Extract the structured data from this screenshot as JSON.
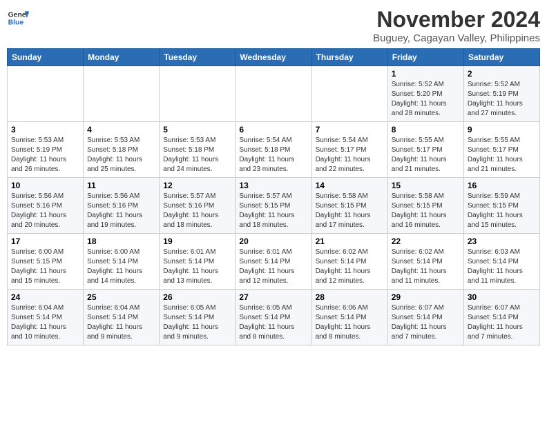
{
  "header": {
    "logo_line1": "General",
    "logo_line2": "Blue",
    "main_title": "November 2024",
    "subtitle": "Buguey, Cagayan Valley, Philippines"
  },
  "days_of_week": [
    "Sunday",
    "Monday",
    "Tuesday",
    "Wednesday",
    "Thursday",
    "Friday",
    "Saturday"
  ],
  "weeks": [
    [
      {
        "day": "",
        "info": ""
      },
      {
        "day": "",
        "info": ""
      },
      {
        "day": "",
        "info": ""
      },
      {
        "day": "",
        "info": ""
      },
      {
        "day": "",
        "info": ""
      },
      {
        "day": "1",
        "info": "Sunrise: 5:52 AM\nSunset: 5:20 PM\nDaylight: 11 hours\nand 28 minutes."
      },
      {
        "day": "2",
        "info": "Sunrise: 5:52 AM\nSunset: 5:19 PM\nDaylight: 11 hours\nand 27 minutes."
      }
    ],
    [
      {
        "day": "3",
        "info": "Sunrise: 5:53 AM\nSunset: 5:19 PM\nDaylight: 11 hours\nand 26 minutes."
      },
      {
        "day": "4",
        "info": "Sunrise: 5:53 AM\nSunset: 5:18 PM\nDaylight: 11 hours\nand 25 minutes."
      },
      {
        "day": "5",
        "info": "Sunrise: 5:53 AM\nSunset: 5:18 PM\nDaylight: 11 hours\nand 24 minutes."
      },
      {
        "day": "6",
        "info": "Sunrise: 5:54 AM\nSunset: 5:18 PM\nDaylight: 11 hours\nand 23 minutes."
      },
      {
        "day": "7",
        "info": "Sunrise: 5:54 AM\nSunset: 5:17 PM\nDaylight: 11 hours\nand 22 minutes."
      },
      {
        "day": "8",
        "info": "Sunrise: 5:55 AM\nSunset: 5:17 PM\nDaylight: 11 hours\nand 21 minutes."
      },
      {
        "day": "9",
        "info": "Sunrise: 5:55 AM\nSunset: 5:17 PM\nDaylight: 11 hours\nand 21 minutes."
      }
    ],
    [
      {
        "day": "10",
        "info": "Sunrise: 5:56 AM\nSunset: 5:16 PM\nDaylight: 11 hours\nand 20 minutes."
      },
      {
        "day": "11",
        "info": "Sunrise: 5:56 AM\nSunset: 5:16 PM\nDaylight: 11 hours\nand 19 minutes."
      },
      {
        "day": "12",
        "info": "Sunrise: 5:57 AM\nSunset: 5:16 PM\nDaylight: 11 hours\nand 18 minutes."
      },
      {
        "day": "13",
        "info": "Sunrise: 5:57 AM\nSunset: 5:15 PM\nDaylight: 11 hours\nand 18 minutes."
      },
      {
        "day": "14",
        "info": "Sunrise: 5:58 AM\nSunset: 5:15 PM\nDaylight: 11 hours\nand 17 minutes."
      },
      {
        "day": "15",
        "info": "Sunrise: 5:58 AM\nSunset: 5:15 PM\nDaylight: 11 hours\nand 16 minutes."
      },
      {
        "day": "16",
        "info": "Sunrise: 5:59 AM\nSunset: 5:15 PM\nDaylight: 11 hours\nand 15 minutes."
      }
    ],
    [
      {
        "day": "17",
        "info": "Sunrise: 6:00 AM\nSunset: 5:15 PM\nDaylight: 11 hours\nand 15 minutes."
      },
      {
        "day": "18",
        "info": "Sunrise: 6:00 AM\nSunset: 5:14 PM\nDaylight: 11 hours\nand 14 minutes."
      },
      {
        "day": "19",
        "info": "Sunrise: 6:01 AM\nSunset: 5:14 PM\nDaylight: 11 hours\nand 13 minutes."
      },
      {
        "day": "20",
        "info": "Sunrise: 6:01 AM\nSunset: 5:14 PM\nDaylight: 11 hours\nand 12 minutes."
      },
      {
        "day": "21",
        "info": "Sunrise: 6:02 AM\nSunset: 5:14 PM\nDaylight: 11 hours\nand 12 minutes."
      },
      {
        "day": "22",
        "info": "Sunrise: 6:02 AM\nSunset: 5:14 PM\nDaylight: 11 hours\nand 11 minutes."
      },
      {
        "day": "23",
        "info": "Sunrise: 6:03 AM\nSunset: 5:14 PM\nDaylight: 11 hours\nand 11 minutes."
      }
    ],
    [
      {
        "day": "24",
        "info": "Sunrise: 6:04 AM\nSunset: 5:14 PM\nDaylight: 11 hours\nand 10 minutes."
      },
      {
        "day": "25",
        "info": "Sunrise: 6:04 AM\nSunset: 5:14 PM\nDaylight: 11 hours\nand 9 minutes."
      },
      {
        "day": "26",
        "info": "Sunrise: 6:05 AM\nSunset: 5:14 PM\nDaylight: 11 hours\nand 9 minutes."
      },
      {
        "day": "27",
        "info": "Sunrise: 6:05 AM\nSunset: 5:14 PM\nDaylight: 11 hours\nand 8 minutes."
      },
      {
        "day": "28",
        "info": "Sunrise: 6:06 AM\nSunset: 5:14 PM\nDaylight: 11 hours\nand 8 minutes."
      },
      {
        "day": "29",
        "info": "Sunrise: 6:07 AM\nSunset: 5:14 PM\nDaylight: 11 hours\nand 7 minutes."
      },
      {
        "day": "30",
        "info": "Sunrise: 6:07 AM\nSunset: 5:14 PM\nDaylight: 11 hours\nand 7 minutes."
      }
    ]
  ],
  "accent_color": "#2a6db5"
}
